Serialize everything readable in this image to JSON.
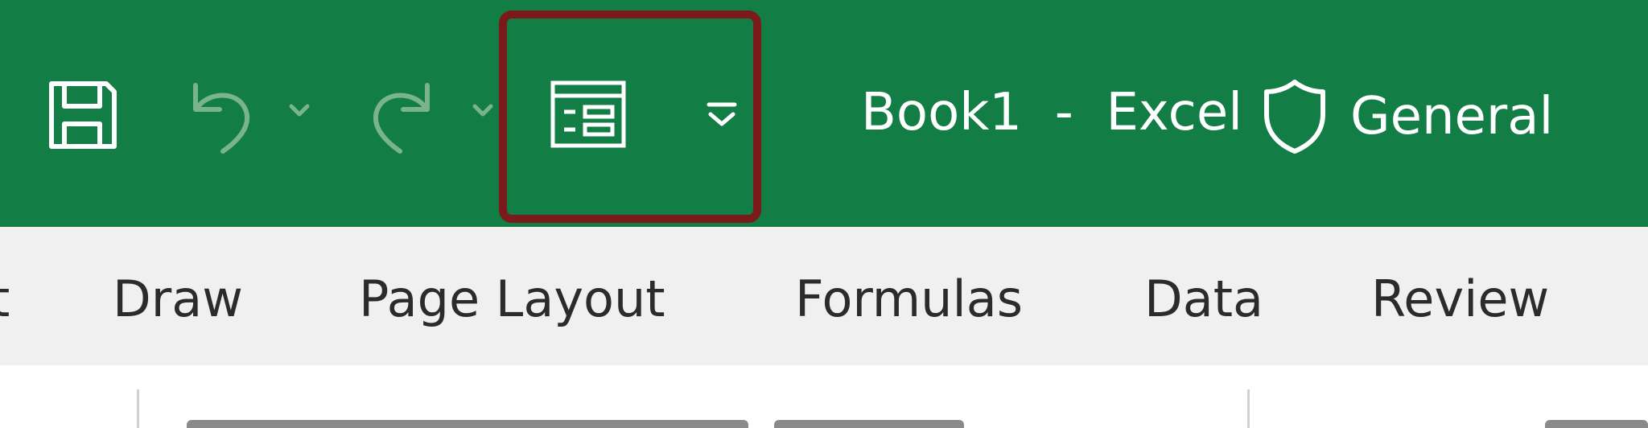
{
  "titlebar": {
    "background_color": "#127d44",
    "title": "Book1  -  Excel",
    "sensitivity_label": "General",
    "sensitivity_icon": "shield-icon"
  },
  "quick_access_toolbar": {
    "save_icon": "save-icon",
    "undo_icon": "undo-icon",
    "redo_icon": "redo-icon",
    "form_icon": "form-icon",
    "customize_icon": "customize-toolbar-icon",
    "highlight_color": "#7b1a1a"
  },
  "ribbon": {
    "tabs": [
      {
        "label": "t"
      },
      {
        "label": "Draw"
      },
      {
        "label": "Page Layout"
      },
      {
        "label": "Formulas"
      },
      {
        "label": "Data"
      },
      {
        "label": "Review"
      }
    ],
    "tab_bar_color": "#f0f0f0"
  }
}
